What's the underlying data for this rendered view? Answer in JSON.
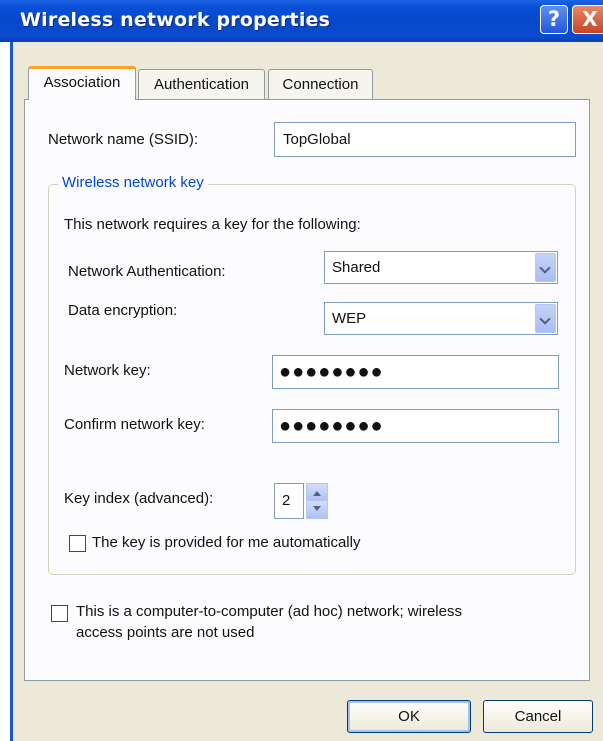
{
  "window": {
    "title": "Wireless network properties",
    "help_glyph": "?",
    "close_glyph": "X"
  },
  "tabs": [
    {
      "label": "Association",
      "active": true
    },
    {
      "label": "Authentication",
      "active": false
    },
    {
      "label": "Connection",
      "active": false
    }
  ],
  "association": {
    "ssid_label": "Network name (SSID):",
    "ssid_value": "TopGlobal",
    "group_title": "Wireless network key",
    "key_required_text": "This network requires a key for the following:",
    "auth_label": "Network Authentication:",
    "auth_value": "Shared",
    "encryption_label": "Data encryption:",
    "encryption_value": "WEP",
    "network_key_label": "Network key:",
    "network_key_value": "●●●●●●●●",
    "confirm_key_label": "Confirm network key:",
    "confirm_key_value": "●●●●●●●●",
    "key_index_label": "Key index (advanced):",
    "key_index_value": "2",
    "auto_key_label": "The key is provided for me automatically",
    "auto_key_checked": false,
    "adhoc_label_line1": "This is a computer-to-computer (ad hoc) network; wireless",
    "adhoc_label_line2": "access points are not used",
    "adhoc_checked": false
  },
  "buttons": {
    "ok": "OK",
    "cancel": "Cancel"
  },
  "colors": {
    "titlebar": "#0648cc",
    "dialog_bg": "#ece9d8",
    "group_title": "#0046d5",
    "active_tab_accent": "#f8a227"
  }
}
